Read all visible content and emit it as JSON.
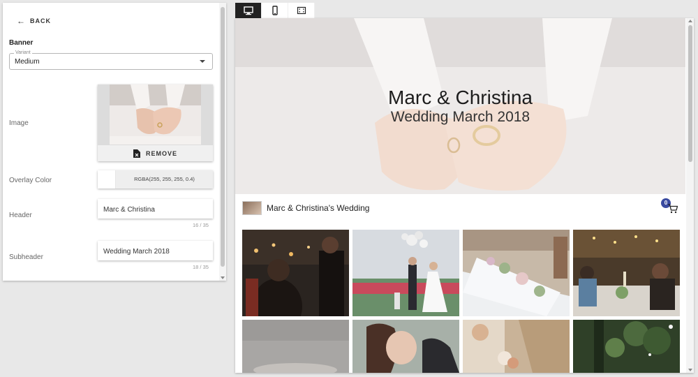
{
  "panel": {
    "back_label": "BACK",
    "section_title": "Banner",
    "variant": {
      "label": "Variant",
      "value": "Medium"
    },
    "image": {
      "label": "Image",
      "remove_label": "REMOVE"
    },
    "overlay": {
      "label": "Overlay Color",
      "value": "RGBA(255, 255, 255, 0.4)"
    },
    "header": {
      "label": "Header",
      "value": "Marc & Christina",
      "counter": "16 / 35"
    },
    "subheader": {
      "label": "Subheader",
      "value": "Wedding March 2018",
      "counter": "18 / 35"
    }
  },
  "toolbar": {
    "buttons": [
      {
        "icon": "desktop-icon",
        "active": true
      },
      {
        "icon": "mobile-icon",
        "active": false
      },
      {
        "icon": "fullscreen-icon",
        "active": false
      }
    ]
  },
  "preview": {
    "banner_title": "Marc & Christina",
    "banner_subtitle": "Wedding March 2018",
    "site_name": "Marc & Christina's Wedding",
    "cart_count": "0"
  },
  "colors": {
    "active_tab": "#222222",
    "badge": "#3a4aa0"
  }
}
